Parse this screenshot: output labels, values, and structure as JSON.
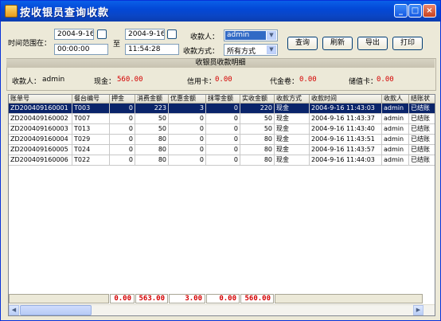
{
  "window": {
    "title": "按收银员查询收款"
  },
  "filters": {
    "time_range_label": "时间范围在：",
    "start_date": "2004-9-16",
    "start_time": "00:00:00",
    "to_label": "至",
    "end_date": "2004-9-16",
    "end_time": "11:54:28",
    "cashier_label": "收款人：",
    "cashier_value": "admin",
    "method_label": "收款方式：",
    "method_value": "所有方式"
  },
  "buttons": {
    "query": "查询",
    "refresh": "刷新",
    "export": "导出",
    "print": "打印"
  },
  "details": {
    "header": "收银员收款明细",
    "cashier_label": "收款人：",
    "cashier_value": "admin",
    "cash_label": "现金：",
    "cash_value": "560.00",
    "card_label": "信用卡：",
    "card_value": "0.00",
    "voucher_label": "代金卷：",
    "voucher_value": "0.00",
    "stored_label": "储值卡：",
    "stored_value": "0.00"
  },
  "table": {
    "columns": [
      "账单号",
      "餐台编号",
      "押金",
      "消费金额",
      "优惠金额",
      "抹零金额",
      "实收金额",
      "收款方式",
      "收款时间",
      "收款人",
      "结账状"
    ],
    "rows": [
      [
        "ZD200409160001",
        "T003",
        "0",
        "223",
        "3",
        "0",
        "220",
        "现金",
        "2004-9-16 11:43:03",
        "admin",
        "已结账"
      ],
      [
        "ZD200409160002",
        "T007",
        "0",
        "50",
        "0",
        "0",
        "50",
        "现金",
        "2004-9-16 11:43:37",
        "admin",
        "已结账"
      ],
      [
        "ZD200409160003",
        "T013",
        "0",
        "50",
        "0",
        "0",
        "50",
        "现金",
        "2004-9-16 11:43:40",
        "admin",
        "已结账"
      ],
      [
        "ZD200409160004",
        "T029",
        "0",
        "80",
        "0",
        "0",
        "80",
        "现金",
        "2004-9-16 11:43:51",
        "admin",
        "已结账"
      ],
      [
        "ZD200409160005",
        "T024",
        "0",
        "80",
        "0",
        "0",
        "80",
        "现金",
        "2004-9-16 11:43:57",
        "admin",
        "已结账"
      ],
      [
        "ZD200409160006",
        "T022",
        "0",
        "80",
        "0",
        "0",
        "80",
        "现金",
        "2004-9-16 11:44:03",
        "admin",
        "已结账"
      ]
    ],
    "selected_row": 0,
    "totals": {
      "deposit": "0.00",
      "consumption": "563.00",
      "discount": "3.00",
      "rounding": "0.00",
      "received": "560.00"
    }
  },
  "colors": {
    "highlight": "#0a246a",
    "amount": "#d40000",
    "titlebar": "#0348d6"
  }
}
